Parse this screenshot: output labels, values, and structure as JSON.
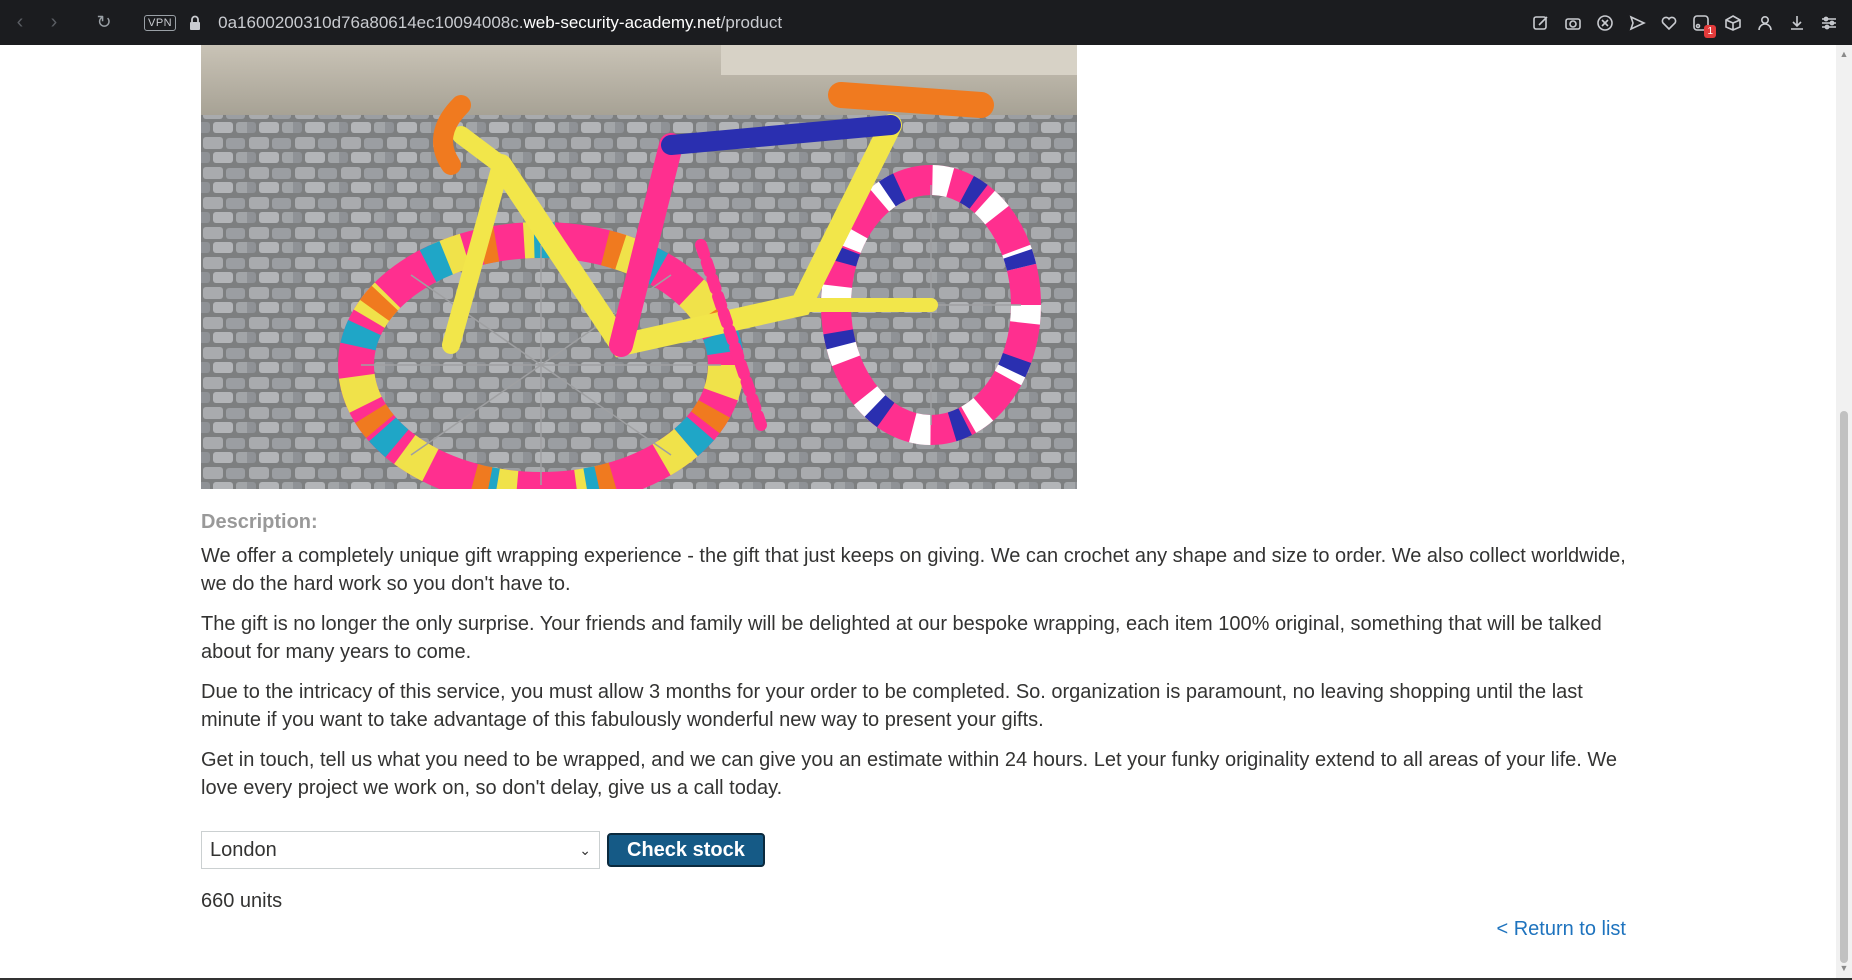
{
  "browser": {
    "vpn_label": "VPN",
    "url_prefix": "0a1600200310d76a80614ec10094008c.",
    "url_host": "web-security-academy.net",
    "url_path": "/product",
    "badge_count": "1",
    "icons": [
      "back-icon",
      "forward-icon",
      "reload-icon",
      "lock-icon",
      "edit-icon",
      "camera-icon",
      "close-circle-icon",
      "send-icon",
      "heart-icon",
      "extensions-icon",
      "cube-icon",
      "profile-icon",
      "download-icon",
      "settings-sliders-icon"
    ]
  },
  "product": {
    "description_label": "Description:",
    "paragraphs": [
      "We offer a completely unique gift wrapping experience - the gift that just keeps on giving. We can crochet any shape and size to order. We also collect worldwide, we do the hard work so you don't have to.",
      "The gift is no longer the only surprise. Your friends and family will be delighted at our bespoke wrapping, each item 100% original, something that will be talked about for many years to come.",
      "Due to the intricacy of this service, you must allow 3 months for your order to be completed. So. organization is paramount, no leaving shopping until the last minute if you want to take advantage of this fabulously wonderful new way to present your gifts.",
      "Get in touch, tell us what you need to be wrapped, and we can give you an estimate within 24 hours. Let your funky originality extend to all areas of your life. We love every project we work on, so don't delay, give us a call today."
    ],
    "store_selected": "London",
    "check_stock_label": "Check stock",
    "stock_result": "660 units",
    "return_link": "< Return to list"
  },
  "colors": {
    "button_bg": "#155a86",
    "link": "#1e73be",
    "label_grey": "#999999"
  }
}
